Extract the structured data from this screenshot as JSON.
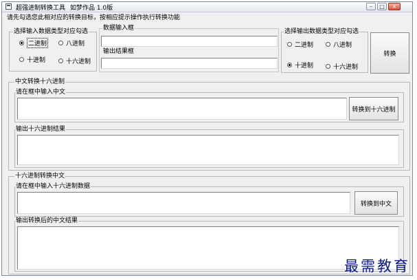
{
  "window": {
    "title": "超强进制转换工具",
    "subtitle": "如梦作品 1.0版"
  },
  "instruction": "请先勾选您此相对应的转换目标，按相应提示操作执行转换功能",
  "input_type": {
    "label": "选择输入数据类型对应勾选",
    "options": [
      "二进制",
      "八进制",
      "十进制",
      "十六进制"
    ],
    "selected": "二进制"
  },
  "data_input": {
    "label": "数据输入框",
    "value": ""
  },
  "data_output": {
    "label": "输出结果框",
    "value": ""
  },
  "output_type": {
    "label": "选择输出数据类型对应勾选",
    "options": [
      "二进制",
      "八进制",
      "十进制",
      "十六进制"
    ],
    "selected": "十进制"
  },
  "convert_button": "转换",
  "cn_to_hex": {
    "label": "中文转换十六进制",
    "input_label": "请在框中输入中文",
    "input_value": "",
    "button": "转换到十六进制",
    "output_label": "输出十六进制结果",
    "output_value": ""
  },
  "hex_to_cn": {
    "label": "十六进制转换中文",
    "input_label": "请在框中输入十六进制数据",
    "input_value": "",
    "button": "转换到中文",
    "output_label": "输出转换后的中文结果",
    "output_value": ""
  },
  "watermark": "最需教育"
}
